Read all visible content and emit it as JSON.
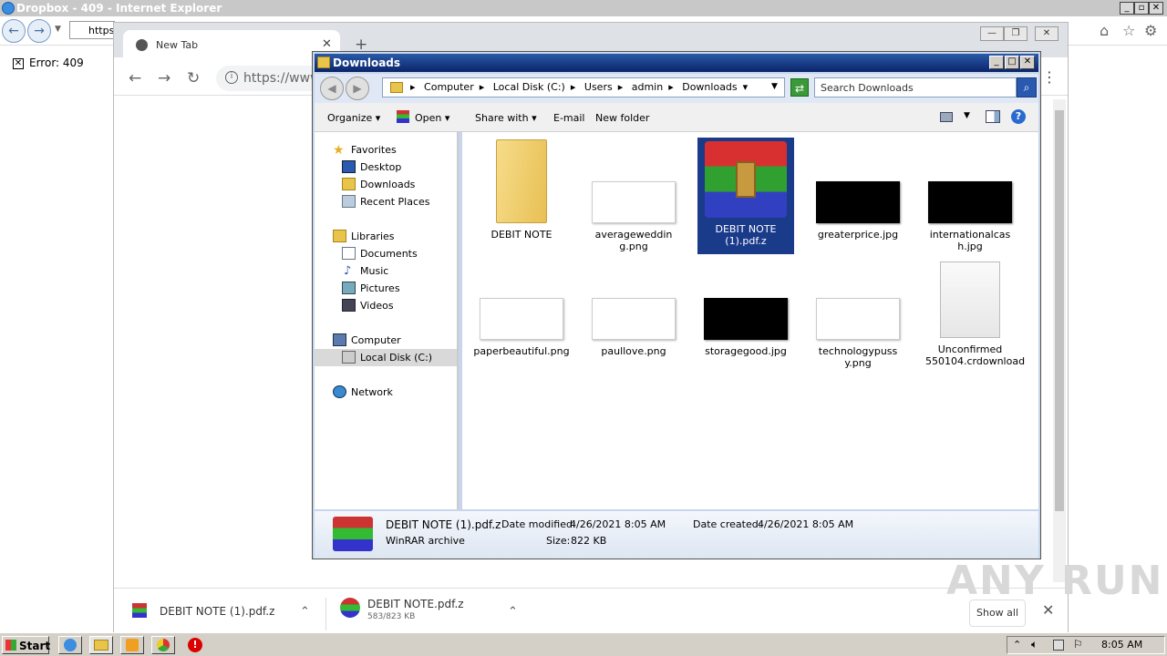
{
  "ie": {
    "title": "Dropbox - 409 - Internet Explorer",
    "address": "https",
    "error": "Error: 409"
  },
  "chrome": {
    "tab_label": "New Tab",
    "omnibox": "https://www",
    "downloads": [
      {
        "name": "DEBIT NOTE (1).pdf.z",
        "size": ""
      },
      {
        "name": "DEBIT NOTE.pdf.z",
        "size": "583/823 KB"
      }
    ],
    "show_all": "Show all"
  },
  "explorer": {
    "title": "Downloads",
    "breadcrumb": [
      "Computer",
      "Local Disk (C:)",
      "Users",
      "admin",
      "Downloads"
    ],
    "search_placeholder": "Search Downloads",
    "commands": [
      "Organize",
      "Open",
      "Share with",
      "E-mail",
      "New folder"
    ],
    "nav": {
      "favorites": "Favorites",
      "desktop": "Desktop",
      "downloads": "Downloads",
      "recent": "Recent Places",
      "libraries": "Libraries",
      "documents": "Documents",
      "music": "Music",
      "pictures": "Pictures",
      "videos": "Videos",
      "computer": "Computer",
      "local_disk": "Local Disk (C:)",
      "network": "Network"
    },
    "files": [
      {
        "name": "DEBIT NOTE",
        "kind": "folder"
      },
      {
        "name": "averagewedding.png",
        "kind": "white-image"
      },
      {
        "name": "DEBIT NOTE (1).pdf.z",
        "kind": "winrar",
        "selected": true
      },
      {
        "name": "greaterprice.jpg",
        "kind": "black-image"
      },
      {
        "name": "internationalcash.jpg",
        "kind": "black-image"
      },
      {
        "name": "paperbeautiful.png",
        "kind": "white-image"
      },
      {
        "name": "paullove.png",
        "kind": "white-image"
      },
      {
        "name": "storagegood.jpg",
        "kind": "black-image"
      },
      {
        "name": "technologypussy.png",
        "kind": "white-image"
      },
      {
        "name": "Unconfirmed 550104.crdownload",
        "kind": "blank-file"
      }
    ],
    "status": {
      "name": "DEBIT NOTE (1).pdf.z",
      "type": "WinRAR archive",
      "modified_label": "Date modified:",
      "modified": "4/26/2021 8:05 AM",
      "created_label": "Date created:",
      "created": "4/26/2021 8:05 AM",
      "size_label": "Size:",
      "size": "822 KB"
    }
  },
  "taskbar": {
    "start": "Start",
    "clock": "8:05 AM"
  },
  "watermark": "ANY RUN"
}
